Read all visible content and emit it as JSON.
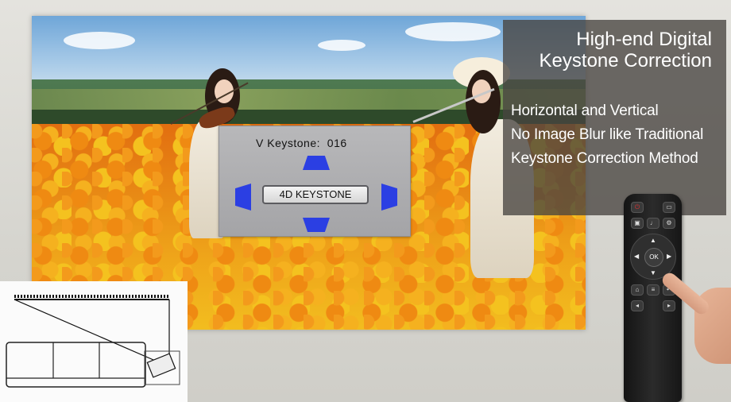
{
  "caption": {
    "title_line1": "High-end Digital",
    "title_line2": "Keystone Correction",
    "features": [
      "Horizontal and Vertical",
      "No Image Blur like Traditional",
      "Keystone Correction Method"
    ]
  },
  "osd": {
    "keystone_label": "V Keystone:",
    "keystone_value": "016",
    "mode_button": "4D KEYSTONE"
  },
  "remote": {
    "ok_label": "OK",
    "icons": [
      "power-icon",
      "mic-icon",
      "settings-icon",
      "up-arrow-icon",
      "down-arrow-icon",
      "left-arrow-icon",
      "right-arrow-icon",
      "home-icon",
      "menu-icon",
      "back-icon",
      "volume-down-icon",
      "volume-up-icon"
    ]
  },
  "colors": {
    "osd_arrow": "#2b3fe3",
    "caption_panel": "#484440",
    "remote_body": "#1e1e1e"
  }
}
